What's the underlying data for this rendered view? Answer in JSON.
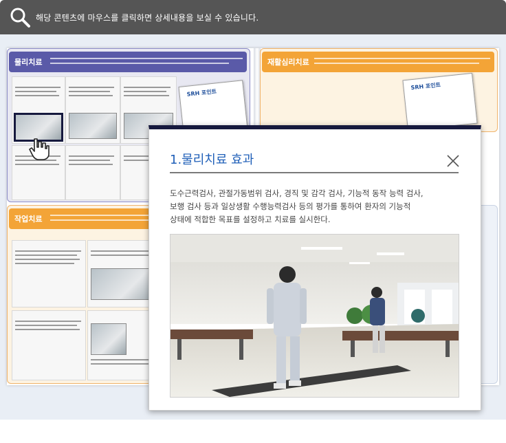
{
  "header": {
    "notice": "해당 콘텐츠에 마우스를 클릭하면 상세내용을 보실 수 있습니다."
  },
  "document": {
    "left_top_section": {
      "label": "물리치료",
      "color": "#5a5aa8"
    },
    "left_bottom_section": {
      "label": "작업치료",
      "color": "#f3a437"
    },
    "right_top_section": {
      "label": "재활심리치료",
      "color": "#f3a437"
    },
    "srh_tags": [
      {
        "title": "SRH 포인트"
      },
      {
        "title": "SRH 포인트"
      }
    ]
  },
  "popup": {
    "title": "1.물리치료 효과",
    "body_lines": [
      "도수근력검사, 관절가동범위 검사, 경직 및 감각 검사, 기능적 동작 능력 검사,",
      "보행 검사 등과 일상생활 수행능력검사 등의 평가를 통하여 환자의 기능적",
      "상태에 적합한 목표를 설정하고 치료를 실시한다."
    ],
    "accent_color": "#1f5fb8",
    "photo_alt": "physical-therapy-gait-training-photo"
  }
}
